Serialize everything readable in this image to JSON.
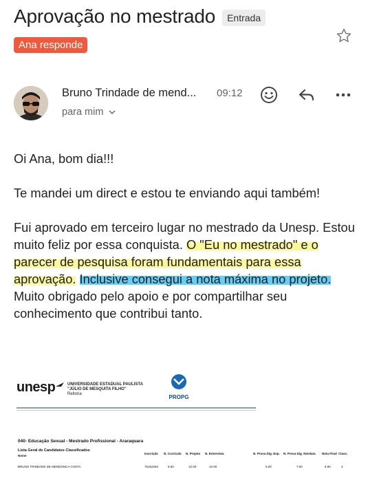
{
  "email": {
    "subject": "Aprovação no mestrado",
    "label": "Entrada",
    "reply_badge": "Ana responde",
    "sender_name": "Bruno Trindade de mend...",
    "time": "09:12",
    "recipient": "para mim",
    "icons": [
      "star-icon",
      "emoji-icon",
      "reply-icon",
      "more-icon",
      "chevron-down-icon"
    ]
  },
  "body": {
    "greeting": "Oi Ana, bom dia!!!",
    "p1": "Te mandei um direct e estou te enviando aqui também!",
    "p2_l1": "Fui aprovado em terceiro lugar no mestrado da Unesp. Estou muito feliz por essa conquista.",
    "p2_hl_yellow": "O \"Eu no mestrado\" e o parecer de pesquisa foram fundamentais para essa aprovação.",
    "p2_hl_blue": "Inclusive consegui a nota máxima no projeto.",
    "p2_end": "Muito obrigado pelo apoio e por compartilhar seu conhecimento que contribui tanto."
  },
  "highlight_colors": {
    "yellow": "#faf68c",
    "blue": "#4ac6f4"
  },
  "attachment": {
    "logo_text": "unesp",
    "university_line1": "UNIVERSIDADE ESTADUAL PAULISTA",
    "university_line2": "\"JÚLIO DE MESQUITA FILHO\"",
    "university_line3": "Reitoria",
    "propg": "PROPG",
    "course": "040- Educação Sexual - Mestrado Profissional - Araraquara",
    "list_title": "Lista Geral de Candidatos Classificados",
    "columns": [
      "Nome",
      "Inscrição",
      "N. Currículo",
      "N. Projeto",
      "N. Entrevista",
      "N. Prova Dig. Esp.",
      "N. Prova Dig. Nivelam.",
      "Nota Final",
      "Class."
    ],
    "row": [
      "BRUNO TRINDADE DE MENDONCA COSTA",
      "75162284",
      "8.50",
      "10.00",
      "10.00",
      "8.00",
      "7.00",
      "8.90",
      "3"
    ]
  }
}
